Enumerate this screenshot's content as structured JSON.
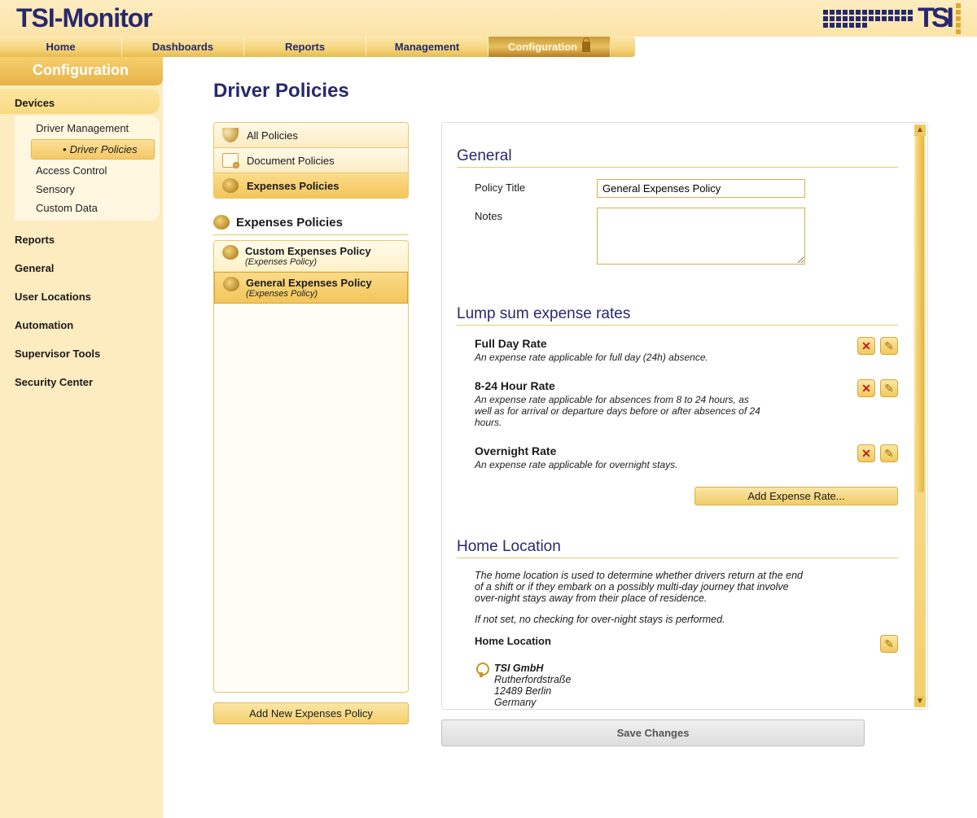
{
  "app_title": "TSI-Monitor",
  "brand": "TSI",
  "top_nav": {
    "items": [
      {
        "label": "Home"
      },
      {
        "label": "Dashboards"
      },
      {
        "label": "Reports"
      },
      {
        "label": "Management"
      },
      {
        "label": "Configuration"
      }
    ]
  },
  "sidebar": {
    "section": "Configuration",
    "group": "Devices",
    "group_items": [
      {
        "label": "Driver Management"
      },
      {
        "label": "Driver Policies"
      },
      {
        "label": "Access Control"
      },
      {
        "label": "Sensory"
      },
      {
        "label": "Custom Data"
      }
    ],
    "links": [
      {
        "label": "Reports"
      },
      {
        "label": "General"
      },
      {
        "label": "User Locations"
      },
      {
        "label": "Automation"
      },
      {
        "label": "Supervisor Tools"
      },
      {
        "label": "Security Center"
      }
    ]
  },
  "page": {
    "title": "Driver Policies"
  },
  "policy_types": [
    {
      "label": "All Policies"
    },
    {
      "label": "Document Policies"
    },
    {
      "label": "Expenses Policies"
    }
  ],
  "policy_panel": {
    "title": "Expenses Policies",
    "items": [
      {
        "title": "Custom Expenses Policy",
        "subtitle": "(Expenses Policy)"
      },
      {
        "title": "General Expenses Policy",
        "subtitle": "(Expenses Policy)"
      }
    ],
    "add_button": "Add New Expenses Policy"
  },
  "detail": {
    "general": {
      "heading": "General",
      "title_label": "Policy Title",
      "title_value": "General Expenses Policy",
      "notes_label": "Notes",
      "notes_value": ""
    },
    "rates": {
      "heading": "Lump sum expense rates",
      "items": [
        {
          "title": "Full Day Rate",
          "desc": "An expense rate applicable for full day (24h) absence."
        },
        {
          "title": "8-24 Hour Rate",
          "desc": "An expense rate applicable for absences from 8 to 24 hours, as well as for arrival or departure days before or after absences of 24 hours."
        },
        {
          "title": "Overnight Rate",
          "desc": "An expense rate applicable for overnight stays."
        }
      ],
      "add_button": "Add Expense Rate..."
    },
    "home": {
      "heading": "Home Location",
      "blurb1": "The home location is used to determine whether drivers return at the end of a shift or if they embark on a possibly multi-day journey that involve over-night stays away from their place of residence.",
      "blurb2": "If not set, no checking for over-night stays is performed.",
      "label": "Home Location",
      "loc_name": "TSI GmbH",
      "loc_street": "Rutherfordstraße",
      "loc_city": "12489 Berlin",
      "loc_country": "Germany"
    },
    "save_button": "Save Changes"
  }
}
